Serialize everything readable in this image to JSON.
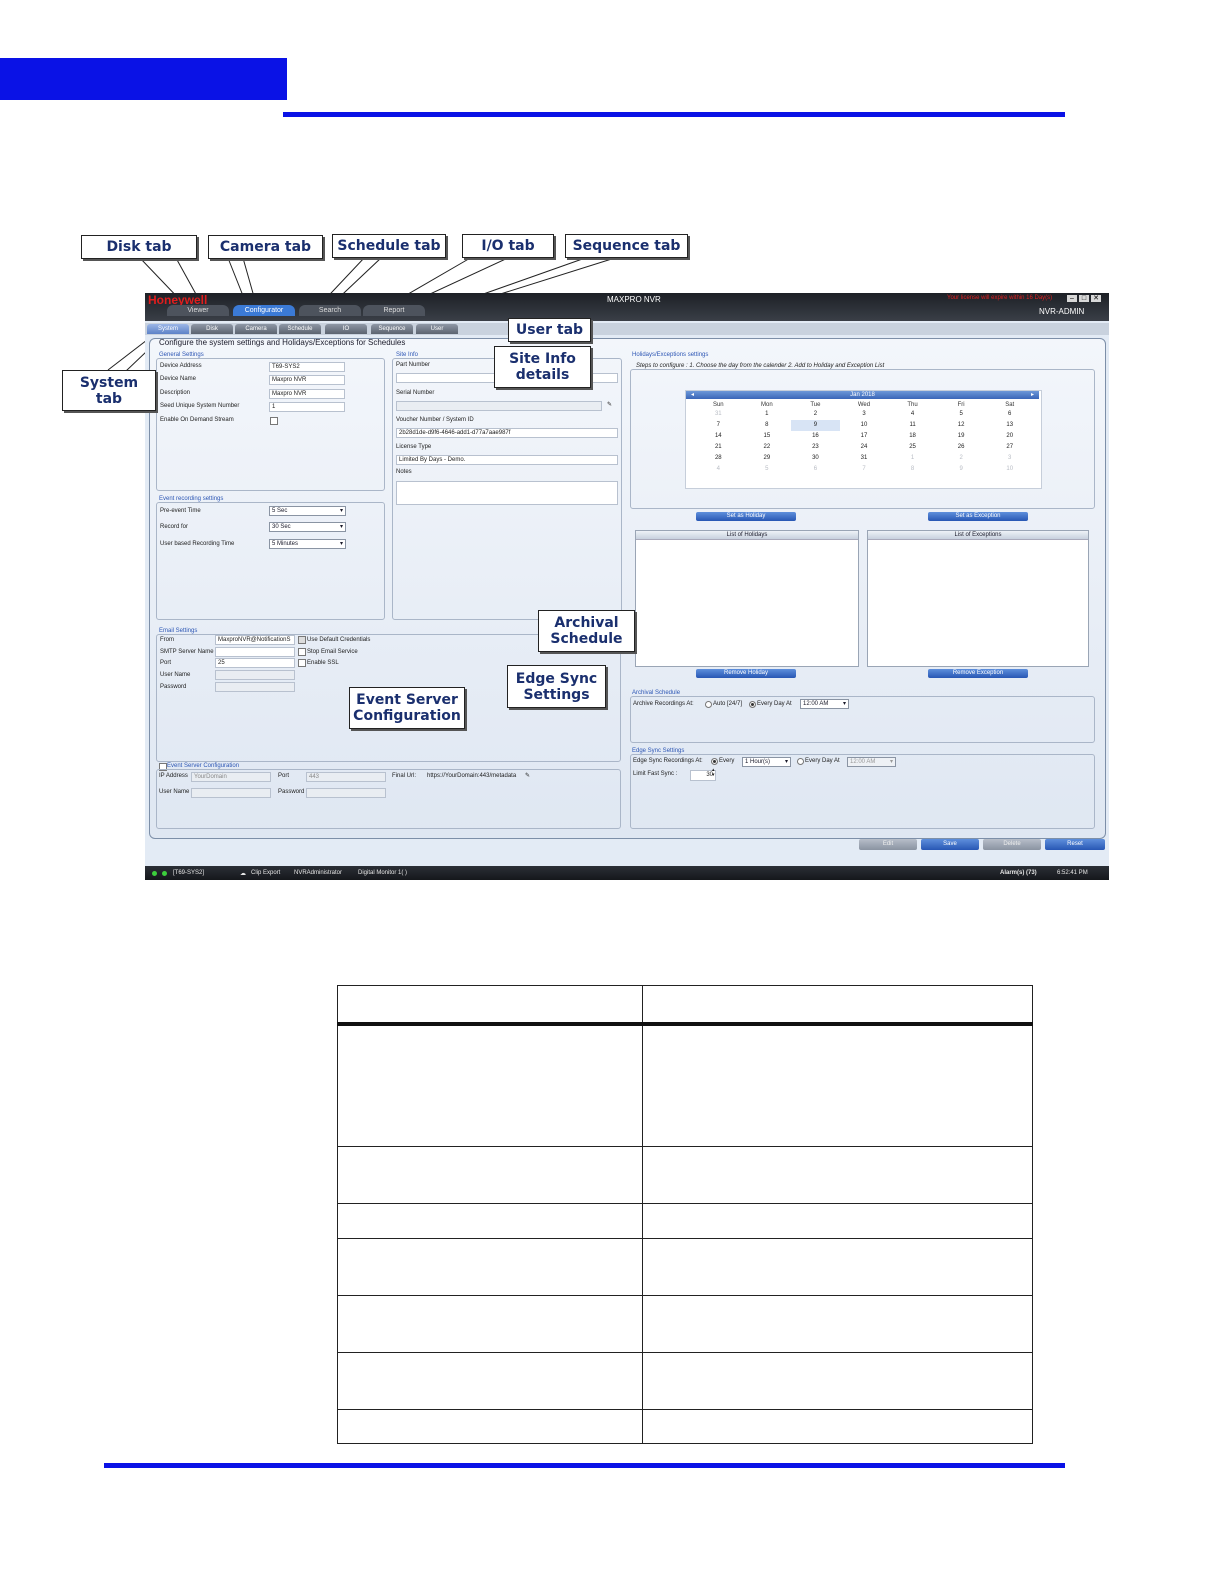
{
  "callouts": {
    "disk": "Disk tab",
    "camera": "Camera tab",
    "schedule": "Schedule tab",
    "io": "I/O tab",
    "sequence": "Sequence tab",
    "user": "User tab",
    "system_l1": "System",
    "system_l2": "tab",
    "siteinfo_l1": "Site Info",
    "siteinfo_l2": "details",
    "archival_l1": "Archival",
    "archival_l2": "Schedule",
    "edgesync_l1": "Edge Sync",
    "edgesync_l2": "Settings",
    "eventserver_l1": "Event Server",
    "eventserver_l2": "Configuration"
  },
  "app": {
    "brand": "Honeywell",
    "title": "MAXPRO NVR",
    "license_warning": "Your license will expire within 16 Day(s)",
    "user": "NVR-ADMIN",
    "main_tabs": [
      "Viewer",
      "Configurator",
      "Search",
      "Report"
    ],
    "sub_tabs": [
      "System",
      "Disk",
      "Camera",
      "Schedule",
      "IO",
      "Sequence",
      "User"
    ],
    "header": "Configure the system settings and Holidays/Exceptions for Schedules",
    "general": {
      "title": "General Settings",
      "device_address_label": "Device Address",
      "device_address": "T69-SYS2",
      "device_name_label": "Device Name",
      "device_name": "Maxpro NVR",
      "description_label": "Description",
      "description": "Maxpro NVR",
      "seed_label": "Seed Unique System Number",
      "seed": "1",
      "ondemand_label": "Enable On Demand Stream"
    },
    "event_recording": {
      "title": "Event recording settings",
      "pre_event_label": "Pre-event Time",
      "pre_event": "5 Sec",
      "record_for_label": "Record for",
      "record_for": "30 Sec",
      "user_based_label": "User based Recording Time",
      "user_based": "5 Minutes"
    },
    "site_info": {
      "title": "Site Info",
      "part_number_label": "Part Number",
      "serial_number_label": "Serial Number",
      "voucher_label": "Voucher Number / System ID",
      "voucher": "2b28d1de-d9f6-4646-add1-d77a7aae987f",
      "license_type_label": "License Type",
      "license_type": "Limited By Days - Demo.",
      "notes_label": "Notes"
    },
    "holidays": {
      "title": "Holidays/Exceptions settings",
      "steps": "Steps to configure : 1. Choose the day from the calender  2. Add to Holiday and Exception List",
      "calendar_title": "Jan 2018",
      "dow": [
        "Sun",
        "Mon",
        "Tue",
        "Wed",
        "Thu",
        "Fri",
        "Sat"
      ],
      "days": [
        "31",
        "1",
        "2",
        "3",
        "4",
        "5",
        "6",
        "7",
        "8",
        "9",
        "10",
        "11",
        "12",
        "13",
        "14",
        "15",
        "16",
        "17",
        "18",
        "19",
        "20",
        "21",
        "22",
        "23",
        "24",
        "25",
        "26",
        "27",
        "28",
        "29",
        "30",
        "31",
        "1",
        "2",
        "3",
        "4",
        "5",
        "6",
        "7",
        "8",
        "9",
        "10"
      ],
      "set_holiday": "Set as Holiday",
      "set_exception": "Set as Exception",
      "list_holidays": "List of Holidays",
      "list_exceptions": "List of Exceptions",
      "remove_holiday": "Remove Holiday",
      "remove_exception": "Remove Exception"
    },
    "email": {
      "title": "Email Settings",
      "from_label": "From",
      "from": "MaxproNVR@NotificationS",
      "default_cred": "Use Default Credentials",
      "smtp_label": "SMTP Server Name",
      "stop_email": "Stop Email Service",
      "port_label": "Port",
      "port": "25",
      "enable_ssl": "Enable SSL",
      "username_label": "User Name",
      "password_label": "Password"
    },
    "archival": {
      "title": "Archival Schedule",
      "label": "Archive Recordings At:",
      "auto": "Auto [24/7]",
      "every_day": "Every Day At",
      "time": "12:00 AM"
    },
    "edge_sync": {
      "title": "Edge Sync Settings",
      "label": "Edge Sync Recordings At:",
      "every": "Every",
      "every_value": "1 Hour(s)",
      "every_day": "Every Day At",
      "every_day_value": "12:00 AM",
      "limit_label": "Limit Fast Sync :",
      "limit_value": "30"
    },
    "event_server": {
      "title": "Event Server Configuration",
      "ip_label": "IP Address",
      "ip_placeholder": "YourDomain",
      "port_label": "Port",
      "port_placeholder": "443",
      "final_url_label": "Final Url:",
      "final_url": "https://YourDomain:443/metadata",
      "username_label": "User Name",
      "password_label": "Password"
    },
    "bottom_buttons": [
      "Edit",
      "Save",
      "Delete",
      "Reset"
    ],
    "statusbar": {
      "system": "[T69-SYS2]",
      "clip_export": "Clip Export",
      "account": "NVRAdministrator",
      "monitor": "Digital Monitor 1( )",
      "alarms": "Alarm(s) (73)",
      "time": "6:52:41 PM"
    }
  },
  "table": {
    "rows": 7
  }
}
